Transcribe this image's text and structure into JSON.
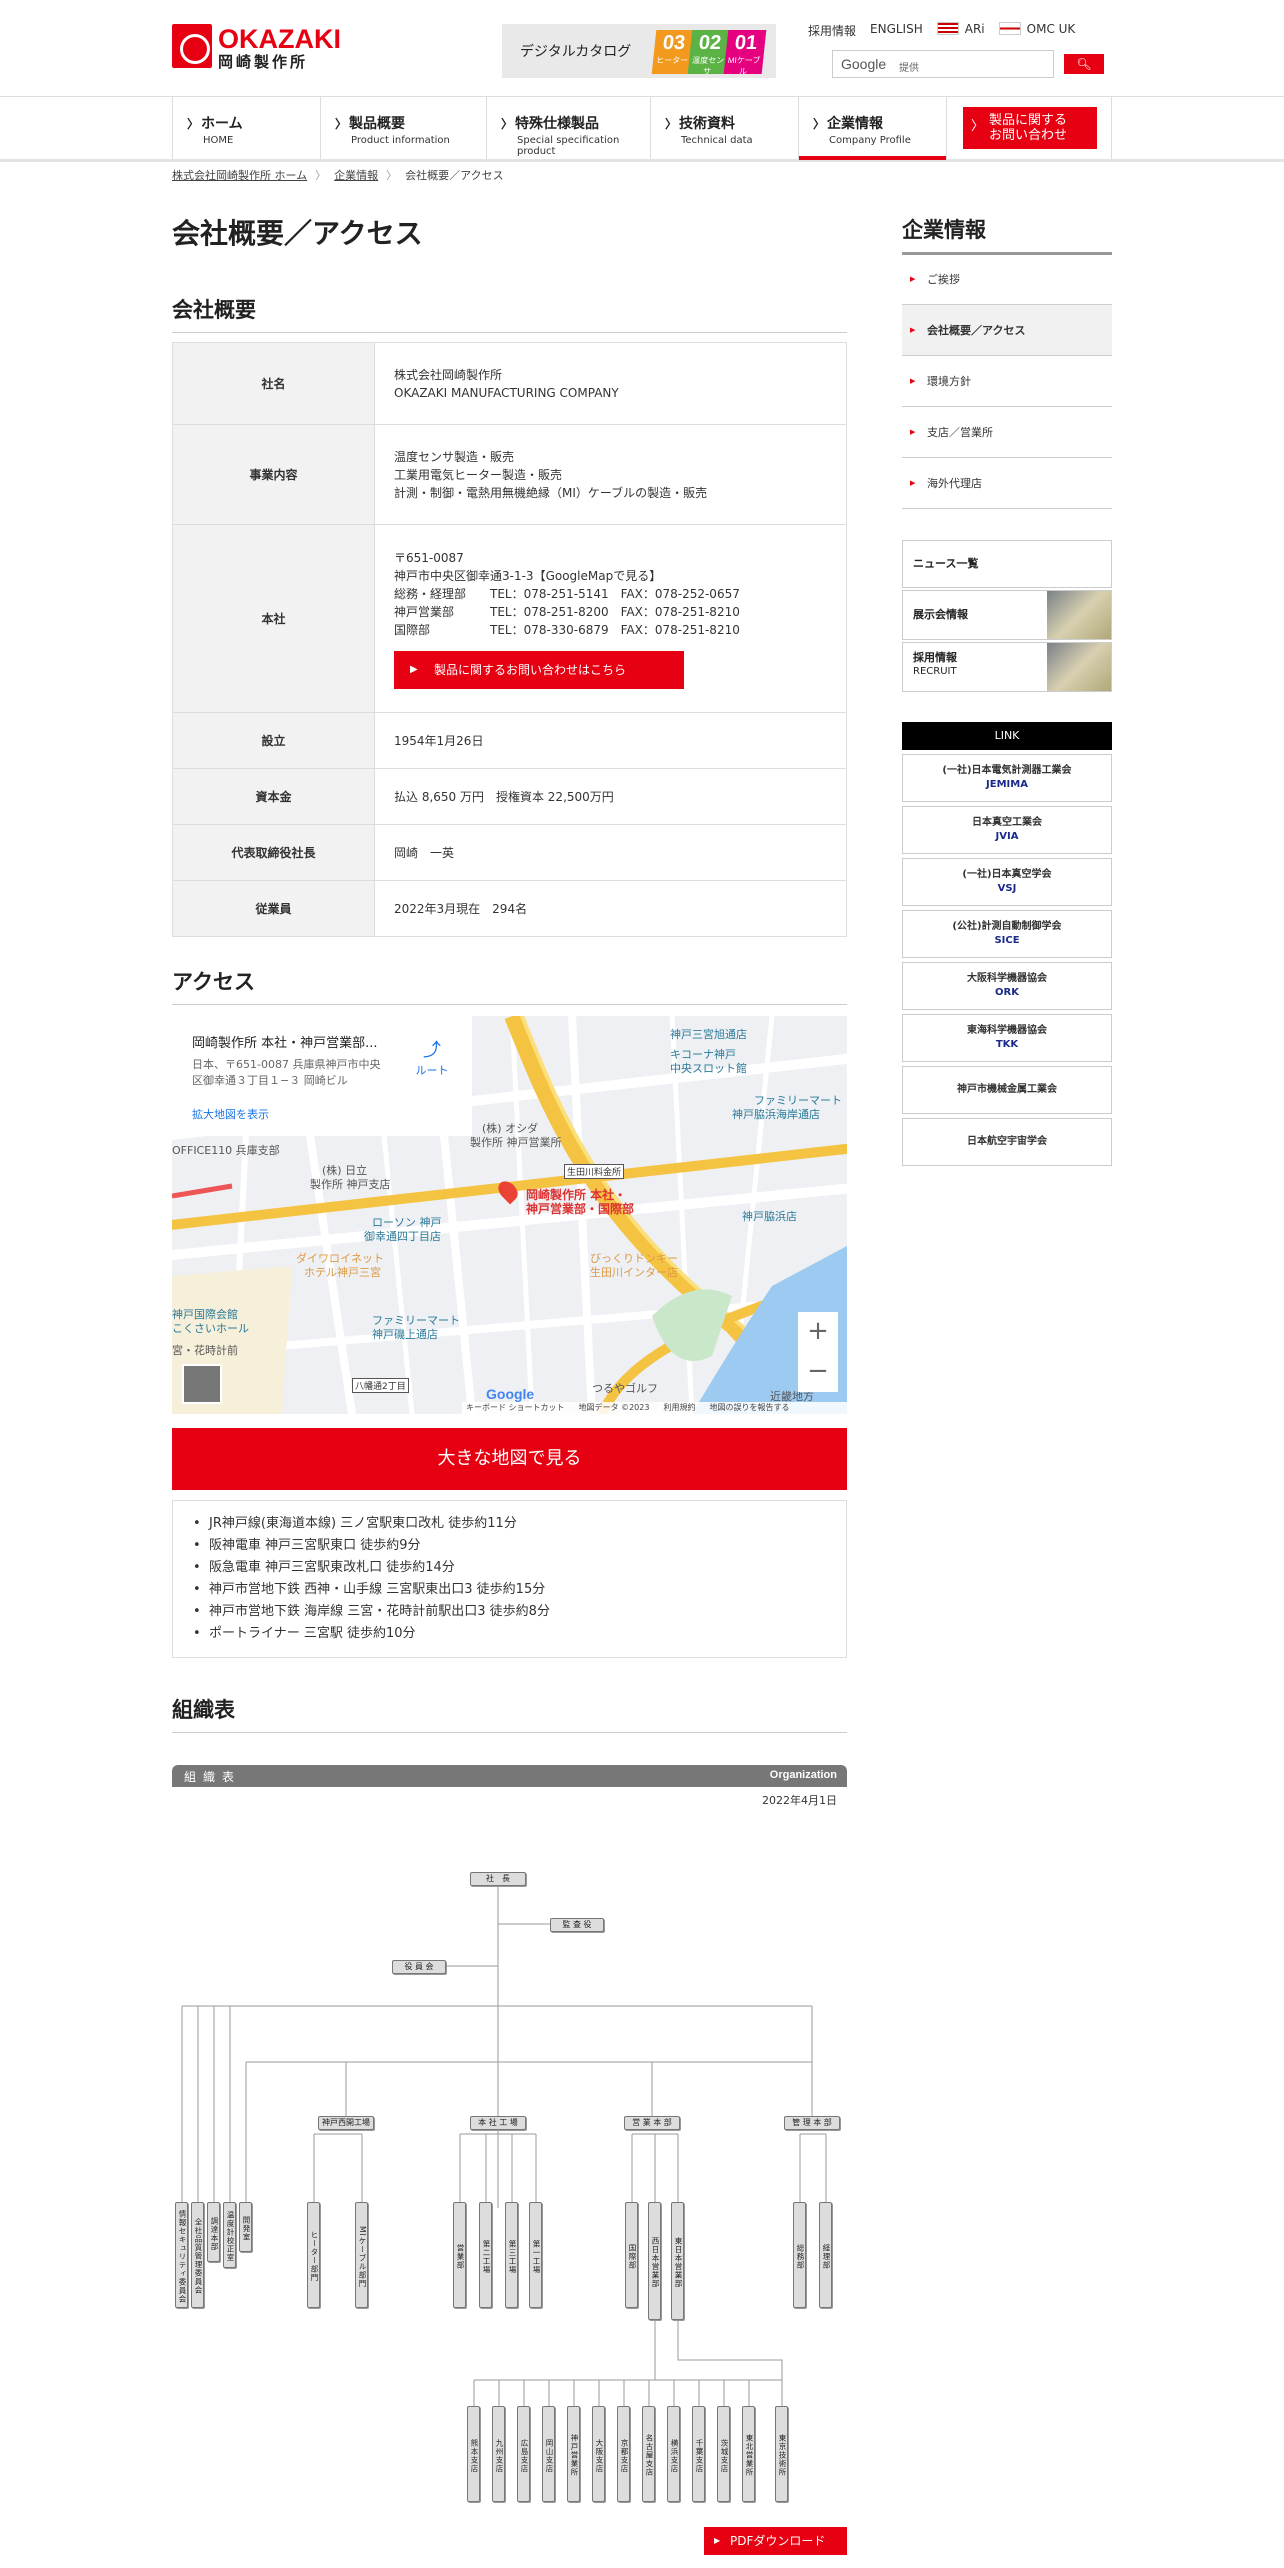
{
  "header": {
    "logo_en": "OKAZAKI",
    "logo_jp": "岡崎製作所",
    "catalog": {
      "label": "デジタルカタログ",
      "items": [
        {
          "num": "03",
          "sub": "ヒーター",
          "color": "#f39a1e"
        },
        {
          "num": "02",
          "sub": "温度センサ",
          "color": "#5bb345"
        },
        {
          "num": "01",
          "sub": "MIケーブル",
          "color": "#e4007f"
        }
      ]
    },
    "toplinks": [
      "採用情報",
      "ENGLISH",
      "ARi",
      "OMC UK"
    ],
    "search": {
      "brand": "Google",
      "placeholder": "提供"
    }
  },
  "nav": {
    "items": [
      {
        "jp": "ホーム",
        "en": "HOME"
      },
      {
        "jp": "製品概要",
        "en": "Product information"
      },
      {
        "jp": "特殊仕様製品",
        "en": "Special specification product"
      },
      {
        "jp": "技術資料",
        "en": "Technical data"
      },
      {
        "jp": "企業情報",
        "en": "Company Profile"
      }
    ],
    "contact_l1": "製品に関する",
    "contact_l2": "お問い合わせ"
  },
  "breadcrumb": [
    "株式会社岡崎製作所 ホーム",
    "企業情報",
    "会社概要／アクセス"
  ],
  "page_title": "会社概要／アクセス",
  "overview": {
    "heading": "会社概要",
    "rows": [
      {
        "label": "社名",
        "lines": [
          "株式会社岡崎製作所",
          "OKAZAKI MANUFACTURING COMPANY"
        ]
      },
      {
        "label": "事業内容",
        "lines": [
          "温度センサ製造・販売",
          "工業用電気ヒーター製造・販売",
          "計測・制御・電熱用無機絶縁（MI）ケーブルの製造・販売"
        ]
      },
      {
        "label": "本社",
        "lines": [
          "〒651-0087",
          "神戸市中央区御幸通3-1-3【GoogleMapで見る】",
          "総務・経理部　　TEL：078-251-5141　FAX：078-252-0657",
          "神戸営業部　　　TEL：078-251-8200　FAX：078-251-8210",
          "国際部　　　　　TEL：078-330-6879　FAX：078-251-8210"
        ],
        "button": "製品に関するお問い合わせはこちら"
      },
      {
        "label": "設立",
        "lines": [
          "1954年1月26日"
        ]
      },
      {
        "label": "資本金",
        "lines": [
          "払込 8,650 万円　授権資本 22,500万円"
        ]
      },
      {
        "label": "代表取締役社長",
        "lines": [
          "岡崎　一英"
        ]
      },
      {
        "label": "従業員",
        "lines": [
          "2022年3月現在　294名"
        ]
      }
    ]
  },
  "access": {
    "heading": "アクセス",
    "map": {
      "place": "岡崎製作所 本社・神戸営業部...",
      "addr1": "日本、〒651-0087 兵庫県神戸市中央",
      "addr2": "区御幸通３丁目１−３ 岡崎ビル",
      "route": "ルート",
      "enlarge": "拡大地図を表示",
      "pin_l1": "岡崎製作所 本社・",
      "pin_l2": "神戸営業部・国際部",
      "labels": [
        "神戸三宮旭通店",
        "キコーナ神戸",
        "中央スロット館",
        "ファミリーマート",
        "神戸脇浜海岸通店",
        "(株) オシダ",
        "製作所 神戸営業所",
        "(株) 日立",
        "製作所 神戸支店",
        "ローソン 神戸",
        "御幸通四丁目店",
        "ダイワロイネット",
        "ホテル神戸三宮",
        "神戸脇浜店",
        "びっくりドンキー",
        "生田川インター店",
        "生田川料金所",
        "ファミリーマート",
        "神戸磯上通店",
        "神戸国際会館",
        "こくさいホール",
        "宮・花時計前",
        "OFFICE110 兵庫支部",
        "八幡通2丁目",
        "つるやゴルフ",
        "近畿地方"
      ],
      "footer": [
        "キーボード ショートカット",
        "地図データ ©2023",
        "利用規約",
        "地図の誤りを報告する"
      ],
      "google": "Google",
      "zoom_in": "+",
      "zoom_out": "−"
    },
    "big_map": "大きな地図で見る",
    "routes": [
      "JR神戸線(東海道本線) 三ノ宮駅東口改札 徒歩約11分",
      "阪神電車 神戸三宮駅東口 徒歩約9分",
      "阪急電車 神戸三宮駅東改札口 徒歩約14分",
      "神戸市営地下鉄 西神・山手線 三宮駅東出口3 徒歩約15分",
      "神戸市営地下鉄 海岸線 三宮・花時計前駅出口3 徒歩約8分",
      "ポートライナー 三宮駅 徒歩約10分"
    ]
  },
  "org": {
    "heading": "組織表",
    "bar_left": "組織表",
    "bar_right": "Organization",
    "date": "2022年4月1日",
    "president": "社　長",
    "auditor": "監 査 役",
    "board": "役 員 会",
    "divisions": [
      "神戸西開工場",
      "本 社 工 場",
      "営 業 本 部",
      "管 理 本 部"
    ],
    "staff_units": [
      "情報セキュリティ委員会",
      "全社品質管理委員会",
      "調達本部",
      "温度計校正室",
      "開発室"
    ],
    "kobe_units": [
      "ヒーター部門",
      "MIケーブル部門"
    ],
    "factory_units": [
      "営業部",
      "第二工場",
      "第三工場",
      "第一工場"
    ],
    "sales_units": [
      "国際部",
      "西日本営業部",
      "東日本営業部"
    ],
    "admin_units": [
      "総務部",
      "経理部"
    ],
    "branches": [
      "熊本支店",
      "九州支店",
      "広島支店",
      "岡山支店",
      "神戸営業所",
      "大阪支店",
      "京都支店",
      "名古屋支店",
      "横浜支店",
      "千葉支店",
      "茨城支店",
      "東北営業所",
      "東京技術所"
    ],
    "pdf": "PDFダウンロード"
  },
  "sidebar": {
    "title": "企業情報",
    "items": [
      "ご挨拶",
      "会社概要／アクセス",
      "環境方針",
      "支店／営業所",
      "海外代理店"
    ],
    "boxes": [
      {
        "l1": "ニュース一覧",
        "l2": ""
      },
      {
        "l1": "展示会情報",
        "l2": ""
      },
      {
        "l1": "採用情報",
        "l2": "RECRUIT"
      }
    ],
    "link_head": "LINK",
    "links": [
      {
        "name": "(一社)日本電気計測器工業会",
        "abbr": "JEMIMA"
      },
      {
        "name": "日本真空工業会",
        "abbr": "JVIA"
      },
      {
        "name": "(一社)日本真空学会",
        "abbr": "VSJ"
      },
      {
        "name": "(公社)計測自動制御学会",
        "abbr": "SICE"
      },
      {
        "name": "大阪科学機器協会",
        "abbr": "ORK"
      },
      {
        "name": "東海科学機器協会",
        "abbr": "TKK"
      },
      {
        "name": "神戸市機械金属工業会",
        "abbr": ""
      },
      {
        "name": "日本航空宇宙学会",
        "abbr": ""
      }
    ]
  },
  "colors": {
    "brand": "#e60012",
    "link": "#1a2a8a"
  }
}
